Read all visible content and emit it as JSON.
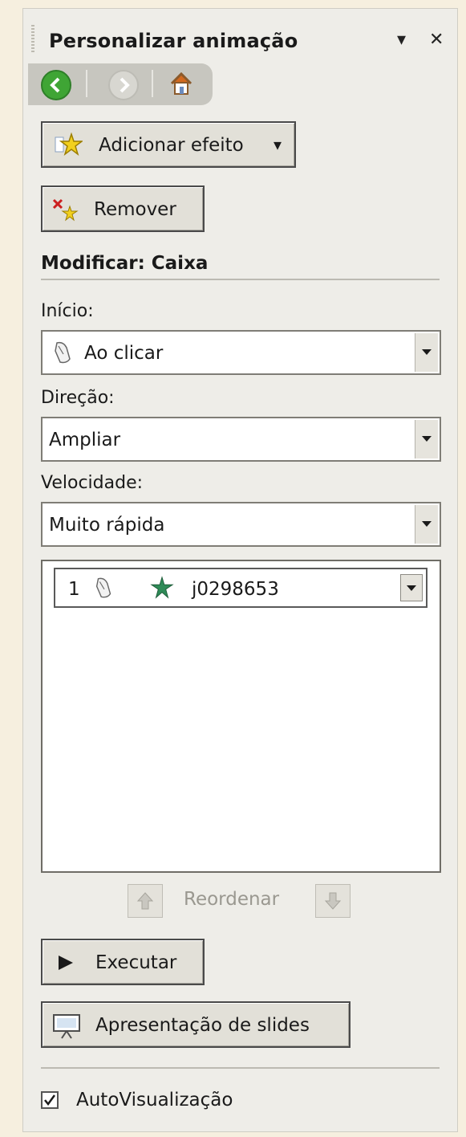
{
  "header": {
    "title": "Personalizar animação",
    "menu_glyph": "▾",
    "close_glyph": "✕"
  },
  "toolbar": {
    "add_effect_label": "Adicionar efeito",
    "add_effect_arrow": "▾",
    "remove_label": "Remover"
  },
  "modify": {
    "title": "Modificar: Caixa",
    "start": {
      "label": "Início:",
      "value": "Ao clicar"
    },
    "direction": {
      "label": "Direção:",
      "value": "Ampliar"
    },
    "speed": {
      "label": "Velocidade:",
      "value": "Muito rápida"
    }
  },
  "effects_list": {
    "items": [
      {
        "number": "1",
        "name": "j0298653"
      }
    ]
  },
  "reorder": {
    "label": "Reordenar"
  },
  "actions": {
    "play_label": "Executar",
    "slideshow_label": "Apresentação de slides"
  },
  "autopreview": {
    "label": "AutoVisualização",
    "checked": true
  },
  "icons": {
    "back": "back-arrow-icon",
    "forward": "forward-arrow-icon",
    "home": "home-icon",
    "add_effect": "star-icon",
    "remove": "remove-effect-icon",
    "start": "mouse-click-icon",
    "effect_type": "entrance-star-icon",
    "play": "play-icon",
    "slideshow": "slideshow-icon"
  },
  "colors": {
    "panel_bg": "#eeede8",
    "nav_bg": "#c7c6bf",
    "back_icon": "#3fa535",
    "star": "#f2d01e",
    "entrance_star": "#2e8b57",
    "text": "#1a1a1a",
    "disabled_text": "#9a9890"
  }
}
